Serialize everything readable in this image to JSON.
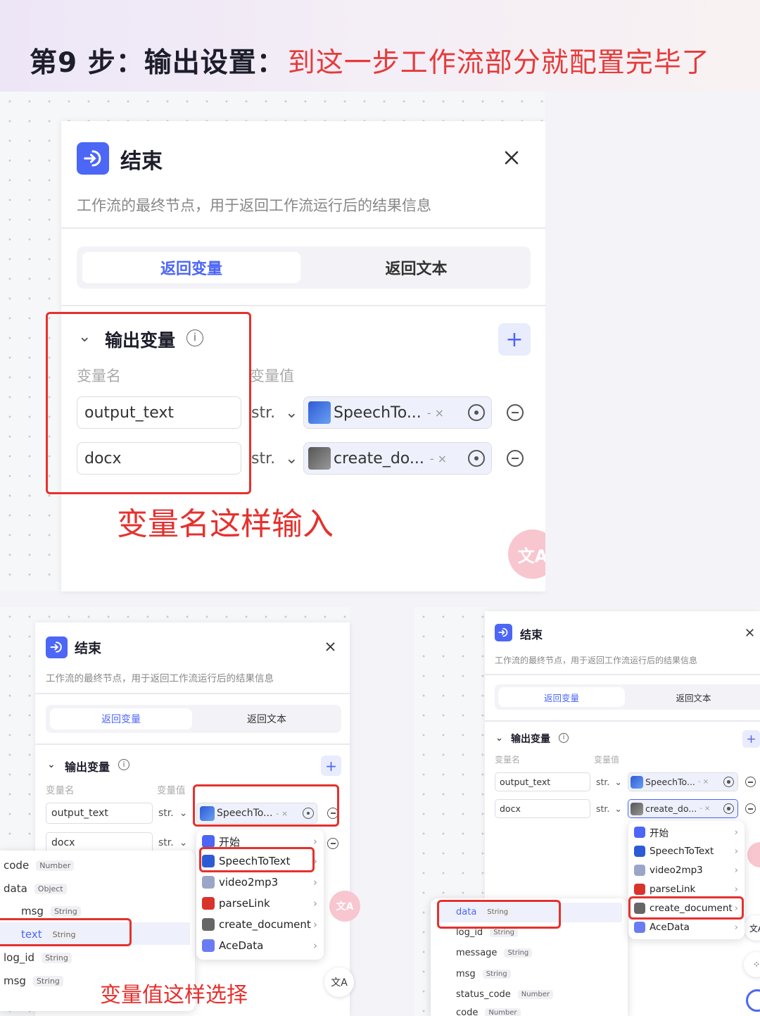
{
  "header": {
    "title": "第9 步：输出设置：",
    "subtitle": "到这一步工作流部分就配置完毕了"
  },
  "node": {
    "title": "结束",
    "description": "工作流的最终节点，用于返回工作流运行后的结果信息"
  },
  "tabs": {
    "return_variable": "返回变量",
    "return_text": "返回文本"
  },
  "output_section": {
    "title": "输出变量",
    "col_name": "变量名",
    "col_value": "变量值"
  },
  "rows": [
    {
      "name": "output_text",
      "type": "str.",
      "ref": "SpeechTo...",
      "ref_suffix": "- ×"
    },
    {
      "name": "docx",
      "type": "str.",
      "ref": "create_do...",
      "ref_suffix": "- ×"
    }
  ],
  "annotations": {
    "name_hint": "变量名这样输入",
    "value_hint": "变量值这样选择"
  },
  "node_menu": [
    {
      "label": "开始",
      "color": "#4c66f6"
    },
    {
      "label": "SpeechToText",
      "color": "#2d5bd6"
    },
    {
      "label": "video2mp3",
      "color": "#9aa6c8"
    },
    {
      "label": "parseLink",
      "color": "#d9342b"
    },
    {
      "label": "create_document",
      "color": "#666666"
    },
    {
      "label": "AceData",
      "color": "#6b7cf2"
    }
  ],
  "vars_left": [
    {
      "name": "code",
      "type": "Number"
    },
    {
      "name": "data",
      "type": "Object"
    },
    {
      "name": "msg",
      "type": "String"
    },
    {
      "name": "text",
      "type": "String"
    },
    {
      "name": "log_id",
      "type": "String"
    },
    {
      "name": "msg",
      "type": "String"
    }
  ],
  "vars_right": [
    {
      "name": "data",
      "type": "String"
    },
    {
      "name": "log_id",
      "type": "String"
    },
    {
      "name": "message",
      "type": "String"
    },
    {
      "name": "msg",
      "type": "String"
    },
    {
      "name": "status_code",
      "type": "Number"
    },
    {
      "name": "code",
      "type": "Number"
    }
  ],
  "colors": {
    "accent": "#4c66f6",
    "highlight": "#e5312e"
  }
}
